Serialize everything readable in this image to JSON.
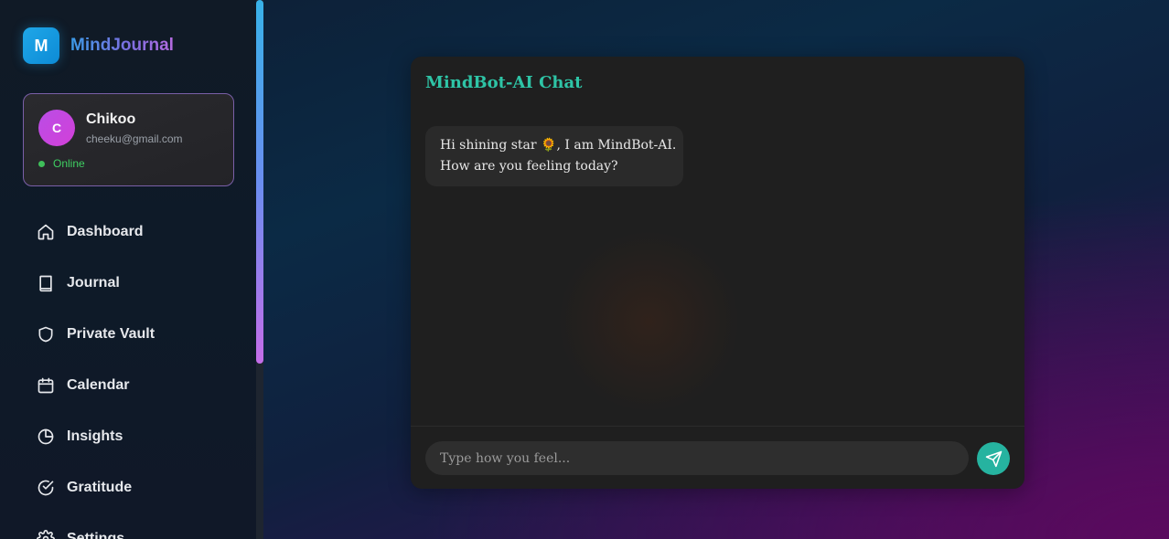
{
  "brand": {
    "logo_letter": "M",
    "name": "MindJournal"
  },
  "user": {
    "initial": "C",
    "name": "Chikoo",
    "email": "cheeku@gmail.com",
    "status": "Online"
  },
  "nav": {
    "items": [
      {
        "label": "Dashboard",
        "icon": "home-icon"
      },
      {
        "label": "Journal",
        "icon": "book-icon"
      },
      {
        "label": "Private Vault",
        "icon": "shield-icon"
      },
      {
        "label": "Calendar",
        "icon": "calendar-icon"
      },
      {
        "label": "Insights",
        "icon": "pie-chart-icon"
      },
      {
        "label": "Gratitude",
        "icon": "check-circle-icon"
      },
      {
        "label": "Settings",
        "icon": "gear-icon"
      }
    ]
  },
  "chat": {
    "title": "MindBot-AI Chat",
    "messages": [
      {
        "sender": "bot",
        "lines": [
          "Hi shining star 🌻, I am MindBot-AI.",
          "How are you feeling today?"
        ]
      }
    ],
    "input_placeholder": "Type how you feel...",
    "input_value": "",
    "send_icon": "send-icon"
  },
  "colors": {
    "accent_teal": "#2ec4a6",
    "brand_blue": "#1fa7e8",
    "avatar_purple": "#c646e0",
    "status_green": "#3fcf62",
    "send_button": "#26b3a0"
  }
}
